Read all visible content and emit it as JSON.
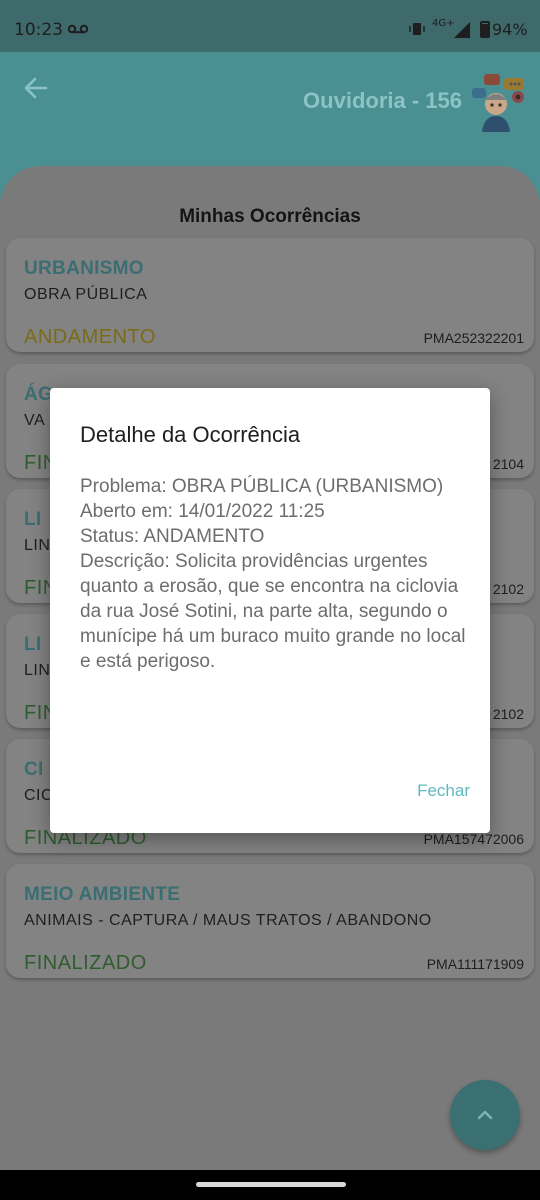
{
  "status_bar": {
    "time": "10:23",
    "network": "4G+",
    "battery": "94%"
  },
  "header": {
    "title": "Ouvidoria - 156"
  },
  "list": {
    "title": "Minhas Ocorrências",
    "items": [
      {
        "category": "URBANISMO",
        "subcategory": "OBRA PÚBLICA",
        "status": "ANDAMENTO",
        "code": "PMA252322201"
      },
      {
        "category": "ÁG",
        "subcategory": "VA",
        "status": "FIN",
        "code": "2104"
      },
      {
        "category": "LI",
        "subcategory": "LIN",
        "status": "FIN",
        "code": "2102"
      },
      {
        "category": "LI",
        "subcategory": "LIN",
        "status": "FIN",
        "code": "2102"
      },
      {
        "category": "CI",
        "subcategory": "CIC",
        "status": "FINALIZADO",
        "code": "PMA157472006"
      },
      {
        "category": "MEIO AMBIENTE",
        "subcategory": "ANIMAIS - CAPTURA / MAUS TRATOS / ABANDONO",
        "status": "FINALIZADO",
        "code": "PMA111171909"
      }
    ]
  },
  "dialog": {
    "title": "Detalhe da Ocorrência",
    "problem": "Problema: OBRA PÚBLICA (URBANISMO)",
    "opened": "Aberto em: 14/01/2022 11:25",
    "status": "Status: ANDAMENTO",
    "description": "Descrição: Solicita providências urgentes quanto a erosão, que se encontra na ciclovia da rua José Sotini, na parte alta, segundo o munícipe há um buraco muito grande no local e está perigoso.",
    "close_label": "Fechar"
  },
  "icons": {
    "back": "arrow-left-icon",
    "fab": "chevron-up-icon",
    "mascot": "ouvidoria-mascot-icon"
  },
  "colors": {
    "accent": "#5fb9bd",
    "andamento": "#c9a800",
    "finalizado": "#3f8a3f"
  }
}
